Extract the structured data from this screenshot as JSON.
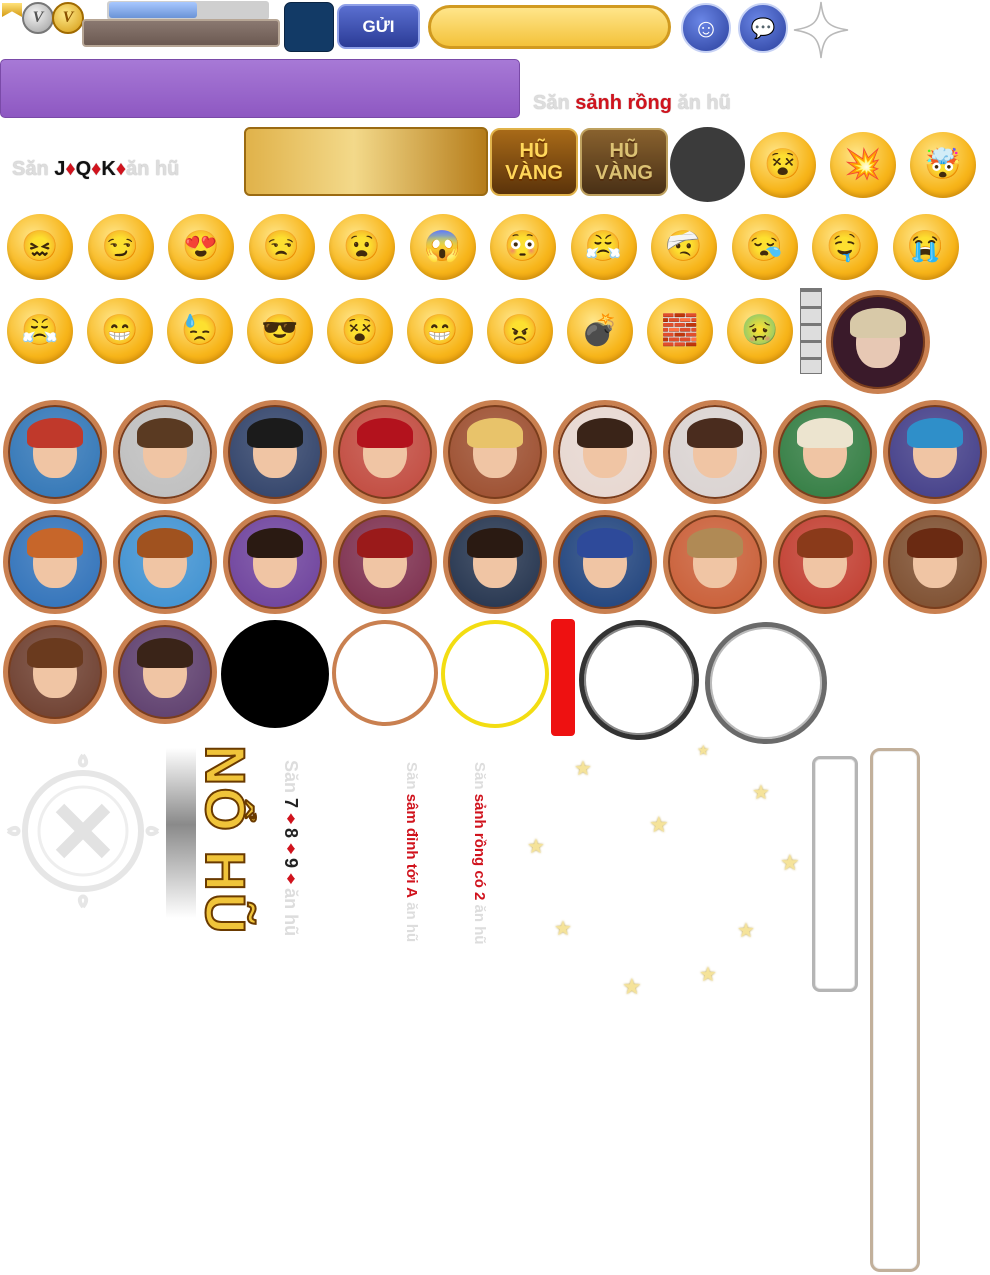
{
  "top_bar": {
    "send_label": "GỬI",
    "chat_input_placeholder": "",
    "coin_v_letter": "V",
    "coin_gold_letter": "V"
  },
  "slot_labels": {
    "sanh_rong": {
      "prefix": "Săn ",
      "highlight": "sảnh rồng",
      "suffix": " ăn hũ"
    },
    "jqk": {
      "prefix": "Săn ",
      "j": "J",
      "q": "Q",
      "k": "K",
      "suffix": "ăn hũ"
    },
    "seven_eight_nine": {
      "prefix": "Săn ",
      "a": "7",
      "b": "8",
      "c": "9",
      "suffix": "ăn hũ"
    },
    "sam_dinh": {
      "prefix": "Săn ",
      "highlight": "sâm đỉnh tới A",
      "suffix": " ăn hũ"
    },
    "sanh_rong_2": {
      "prefix": "Săn ",
      "highlight": "sảnh rồng có 2",
      "suffix": " ăn hũ"
    },
    "diamond": "♦"
  },
  "jackpot_badges": [
    {
      "line1": "HŨ",
      "line2": "VÀNG"
    },
    {
      "line1": "HŨ",
      "line2": "VÀNG"
    }
  ],
  "no_hu_text": "NỔ HŨ",
  "emojis": {
    "row1": [
      "😵",
      "💥",
      "🤯"
    ],
    "row2": [
      "😖",
      "😏",
      "😍",
      "😒",
      "😧",
      "😱",
      "😳",
      "😤",
      "🤕",
      "😪",
      "🤤",
      "😭"
    ],
    "row3": [
      "😤",
      "😁",
      "😓",
      "😎",
      "😵",
      "😁",
      "😠",
      "💣",
      "🧱",
      "🤢"
    ]
  },
  "avatars": {
    "row1": [
      {
        "name": "cyber-girl",
        "bg": "#2d73b5",
        "hair": "#c0392b"
      },
      {
        "name": "brunette-man",
        "bg": "#bdbdbd",
        "hair": "#5a3a22"
      },
      {
        "name": "suit-man",
        "bg": "#2c3e66",
        "hair": "#1b1b1b"
      },
      {
        "name": "red-cap-man",
        "bg": "#c0463a",
        "hair": "#b3121d"
      },
      {
        "name": "blonde-woman",
        "bg": "#9a4a2a",
        "hair": "#e8c36a"
      },
      {
        "name": "dark-hair-woman",
        "bg": "#e6d6cf",
        "hair": "#3a2418"
      },
      {
        "name": "long-hair-woman",
        "bg": "#d9d2d0",
        "hair": "#4a2c1e"
      },
      {
        "name": "chief-man",
        "bg": "#2e7a3e",
        "hair": "#ece4cf"
      },
      {
        "name": "alien-card",
        "bg": "#3f3a86",
        "hair": "#2f8fc9"
      }
    ],
    "row2": [
      {
        "name": "redhead-woman",
        "bg": "#2c6fb8",
        "hair": "#c7662a"
      },
      {
        "name": "young-man",
        "bg": "#3b8fd0",
        "hair": "#a0521f"
      },
      {
        "name": "pirate",
        "bg": "#6a3d9a",
        "hair": "#2a1a12"
      },
      {
        "name": "clown",
        "bg": "#7a2a4a",
        "hair": "#9a1a1a"
      },
      {
        "name": "glasses-man",
        "bg": "#1f2f4a",
        "hair": "#2a1a12"
      },
      {
        "name": "cool-man",
        "bg": "#1b3f7a",
        "hair": "#2e4a9a"
      },
      {
        "name": "cowboy",
        "bg": "#c85a32",
        "hair": "#b08a55"
      },
      {
        "name": "auburn-woman",
        "bg": "#c0392b",
        "hair": "#8a3a1a"
      },
      {
        "name": "glasses-woman",
        "bg": "#7a4a2a",
        "hair": "#6a2a12"
      }
    ],
    "row3": [
      {
        "name": "brown-hair-woman",
        "bg": "#6a3a2a",
        "hair": "#6a3a1e"
      },
      {
        "name": "bunny-woman",
        "bg": "#5a3a6a",
        "hair": "#3a2418"
      }
    ],
    "vampire": {
      "name": "vampire",
      "bg": "#3a1a2a",
      "hair": "#d8c9a8"
    }
  },
  "colors": {
    "purple_banner": "#9b64c8",
    "red_accent": "#d0131d",
    "gold": "#f0c43a",
    "navy": "#123a66"
  }
}
